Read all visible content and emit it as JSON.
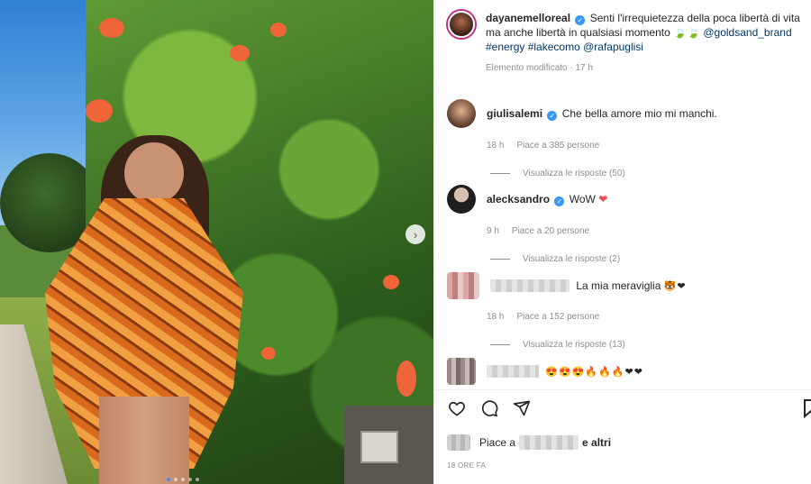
{
  "post": {
    "author": "dayanemelloreal",
    "caption": "Senti l'irrequietezza della poca libertà di vita ma anche libertà in qualsiasi momento",
    "caption_emoji": "🍃🍃",
    "tags": [
      "@goldsand_brand",
      "#energy",
      "#lakecomo",
      "@rafapuglisi"
    ],
    "edited": "Elemento modificato · 17 h"
  },
  "comments": [
    {
      "user": "giulisalemi",
      "text": "Che bella amore mio mi manchi.",
      "time": "18 h",
      "likes": "Piace a 385 persone",
      "replies": "Visualizza le risposte (50)"
    },
    {
      "user": "alecksandro",
      "text": "WoW",
      "text_emoji": "❤",
      "time": "9 h",
      "likes": "Piace a 20 persone",
      "replies": "Visualizza le risposte (2)"
    },
    {
      "text": "La mia meraviglia",
      "text_emoji": "🐯❤",
      "time": "18 h",
      "likes": "Piace a 152 persone",
      "replies": "Visualizza le risposte (13)"
    },
    {
      "text_emoji": "😍😍😍🔥🔥🔥❤❤"
    }
  ],
  "footer": {
    "likes_prefix": "Piace a",
    "likes_suffix": "e altri",
    "timestamp": "18 ORE FA"
  },
  "icons": {
    "like": "heart-outline-icon",
    "comment": "comment-bubble-icon",
    "share": "paper-plane-icon",
    "save": "bookmark-icon",
    "next": "chevron-right-icon"
  },
  "colors": {
    "verified": "#3897f0",
    "link": "#00376b",
    "heart": "#ed4956",
    "muted": "#8e8e8e"
  }
}
